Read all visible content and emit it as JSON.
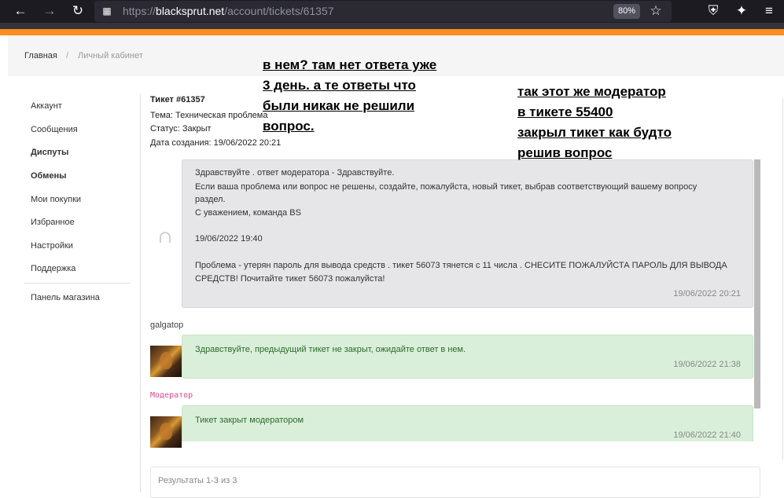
{
  "browser": {
    "url_scheme": "https://",
    "url_host": "blacksprut.net",
    "url_path": "/account/tickets/61357",
    "zoom": "80%",
    "back_icon": "arrow-left-icon",
    "forward_icon": "arrow-right-icon",
    "reload_icon": "reload-icon"
  },
  "breadcrumb": {
    "home": "Главная",
    "separator": "/",
    "current": "Личный кабинет"
  },
  "sidebar": {
    "items": [
      {
        "label": "Аккаунт",
        "bold": false
      },
      {
        "label": "Сообщения",
        "bold": false
      },
      {
        "label": "Диспуты",
        "bold": true
      },
      {
        "label": "Обмены",
        "bold": true
      },
      {
        "label": "Мои покупки",
        "bold": false
      },
      {
        "label": "Избранное",
        "bold": false
      },
      {
        "label": "Настройки",
        "bold": false
      },
      {
        "label": "Поддержка",
        "bold": false
      }
    ],
    "shop_panel": "Панель магазина"
  },
  "ticket": {
    "title": "Тикет #61357",
    "topic": "Тема: Техническая проблема",
    "status": "Статус: Закрыт",
    "created": "Дата создания: 19/06/2022 20:21"
  },
  "messages": [
    {
      "author": "",
      "lines": [
        "Здравствуйте . ответ модератора - Здравствуйте.",
        "Если ваша проблема или вопрос не решены, создайте, пожалуйста, новый тикет, выбрав соответствующий вашему вопросу",
        "раздел.",
        "С уважением, команда BS",
        "",
        "19/06/2022 19:40",
        "",
        "Проблема - утерян пароль для вывода средств . тикет 56073 тянется с 11 числа . СНЕСИТЕ ПОЖАЛУЙСТА ПАРОЛЬ ДЛЯ ВЫВОДА",
        "СРЕДСТВ! Почитайте тикет 56073 пожалуйста!"
      ],
      "time": "19/06/2022 20:21"
    },
    {
      "author": "galgatop",
      "lines": [
        "Здравствуйте, предыдущий тикет не закрыт, ожидайте ответ в нем."
      ],
      "time": "19/06/2022 21:38"
    },
    {
      "author": "Модератор",
      "lines": [
        "Тикет закрыт модератором"
      ],
      "time": "19/06/2022 21:40"
    }
  ],
  "results": "Результаты 1-3 из 3",
  "annotations": {
    "left": [
      "в нем?  там нет ответа уже",
      "3 день. а те ответы что",
      "были  никак не решили",
      "вопрос."
    ],
    "right": [
      "так этот же модератор",
      "в  тикете 55400",
      "закрыл тикет как будто",
      "решив вопрос"
    ]
  },
  "colors": {
    "accent_orange": "#fb8c1e",
    "moderator_pink": "#e0448f",
    "reply_green": "#d9efd9"
  }
}
